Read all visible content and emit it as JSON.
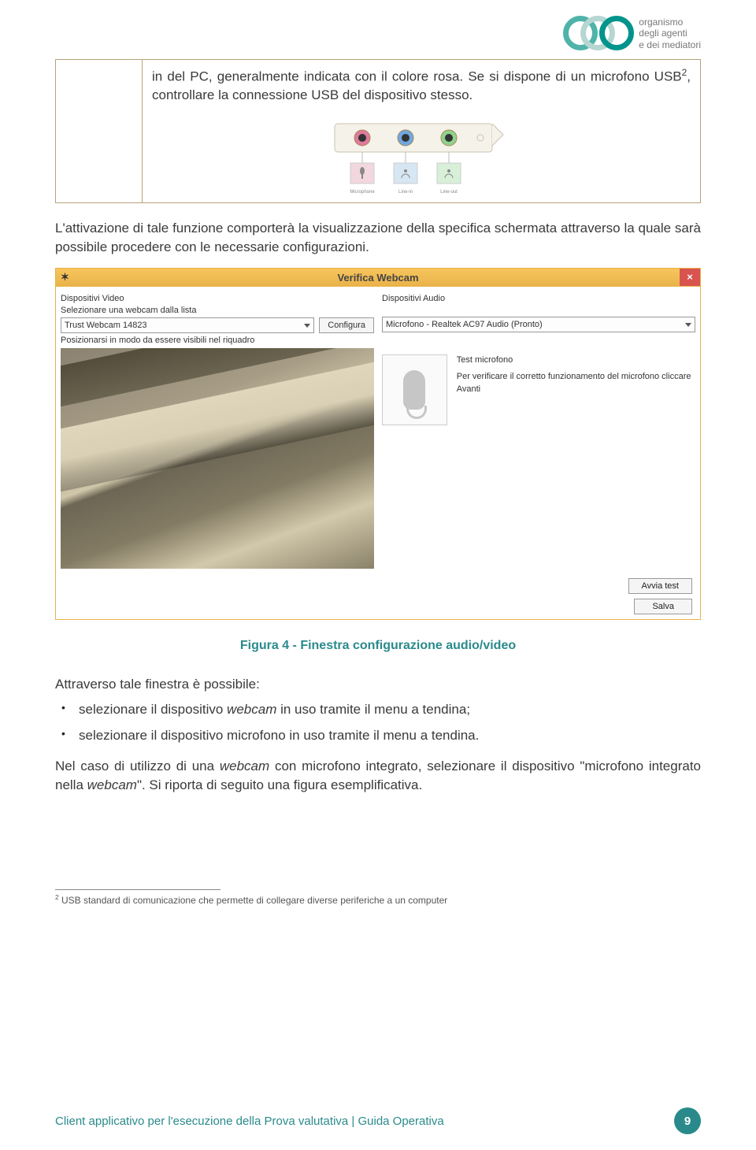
{
  "header": {
    "logo_brand_lines": [
      "organismo",
      "degli agenti",
      "e dei mediatori"
    ]
  },
  "box": {
    "cell_text_a": "in del PC, generalmente indicata con il colore rosa. Se si dispone di un microfono USB",
    "cell_sup": "2",
    "cell_text_b": ", controllare la connessione USB del dispositivo stesso."
  },
  "paragraph1": "L'attivazione di tale funzione comporterà la visualizzazione della specifica schermata attraverso la quale sarà possibile procedere con le necessarie configurazioni.",
  "screenshot": {
    "title": "Verifica Webcam",
    "close": "×",
    "left": {
      "heading": "Dispositivi Video",
      "select_label": "Selezionare una webcam dalla lista",
      "select_value": "Trust Webcam 14823",
      "configure_btn": "Configura",
      "position_label": "Posizionarsi in modo da essere visibili nel riquadro"
    },
    "right": {
      "heading": "Dispositivi Audio",
      "select_value": "Microfono - Realtek AC97 Audio (Pronto)",
      "test_title": "Test microfono",
      "test_desc": "Per verificare il corretto funzionamento del microfono cliccare Avanti",
      "start_btn": "Avvia test",
      "save_btn": "Salva"
    }
  },
  "caption": "Figura 4 - Finestra configurazione audio/video",
  "list_intro": "Attraverso tale finestra è possibile:",
  "bullets": [
    {
      "a": "selezionare il dispositivo ",
      "i": "webcam",
      "b": " in uso tramite il menu a tendina;"
    },
    {
      "a": "selezionare il dispositivo microfono in uso tramite il menu a tendina.",
      "i": "",
      "b": ""
    }
  ],
  "paragraph2": {
    "a": "Nel caso di utilizzo di una ",
    "i1": "webcam",
    "b": " con microfono integrato, selezionare il dispositivo \"microfono integrato nella ",
    "i2": "webcam",
    "c": "\". Si riporta di seguito una figura esemplificativa."
  },
  "footnote": {
    "num": "2",
    "text": " USB standard di comunicazione che permette di collegare diverse periferiche a un computer"
  },
  "footer": {
    "text": "Client applicativo per l'esecuzione della Prova valutativa | Guida Operativa",
    "page": "9"
  }
}
